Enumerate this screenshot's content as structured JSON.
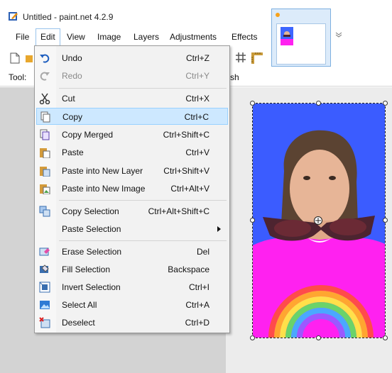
{
  "window": {
    "title": "Untitled - paint.net 4.2.9"
  },
  "menubar": {
    "items": [
      {
        "label": "File"
      },
      {
        "label": "Edit"
      },
      {
        "label": "View"
      },
      {
        "label": "Image"
      },
      {
        "label": "Layers"
      },
      {
        "label": "Adjustments"
      },
      {
        "label": "Effects"
      }
    ]
  },
  "toolbar": {
    "tool_label": "Tool:",
    "tool_rest": "sh"
  },
  "edit_menu": {
    "items": [
      {
        "label": "Undo",
        "shortcut": "Ctrl+Z",
        "icon": "undo-icon"
      },
      {
        "label": "Redo",
        "shortcut": "Ctrl+Y",
        "icon": "redo-icon"
      },
      {
        "label": "Cut",
        "shortcut": "Ctrl+X",
        "icon": "scissors-icon"
      },
      {
        "label": "Copy",
        "shortcut": "Ctrl+C",
        "icon": "copy-icon"
      },
      {
        "label": "Copy Merged",
        "shortcut": "Ctrl+Shift+C",
        "icon": "copy-merged-icon"
      },
      {
        "label": "Paste",
        "shortcut": "Ctrl+V",
        "icon": "paste-icon"
      },
      {
        "label": "Paste into New Layer",
        "shortcut": "Ctrl+Shift+V",
        "icon": "paste-new-layer-icon"
      },
      {
        "label": "Paste into New Image",
        "shortcut": "Ctrl+Alt+V",
        "icon": "paste-new-image-icon"
      },
      {
        "label": "Copy Selection",
        "shortcut": "Ctrl+Alt+Shift+C",
        "icon": "copy-selection-icon"
      },
      {
        "label": "Paste Selection",
        "shortcut": "",
        "icon": ""
      },
      {
        "label": "Erase Selection",
        "shortcut": "Del",
        "icon": "erase-selection-icon"
      },
      {
        "label": "Fill Selection",
        "shortcut": "Backspace",
        "icon": "fill-selection-icon"
      },
      {
        "label": "Invert Selection",
        "shortcut": "Ctrl+I",
        "icon": "invert-selection-icon"
      },
      {
        "label": "Select All",
        "shortcut": "Ctrl+A",
        "icon": "select-all-icon"
      },
      {
        "label": "Deselect",
        "shortcut": "Ctrl+D",
        "icon": "deselect-icon"
      }
    ],
    "highlighted": "Copy"
  },
  "colors": {
    "menu_highlight": "#cde8ff",
    "photo_background": "#3b5cff",
    "shirt": "#ff21f0"
  }
}
